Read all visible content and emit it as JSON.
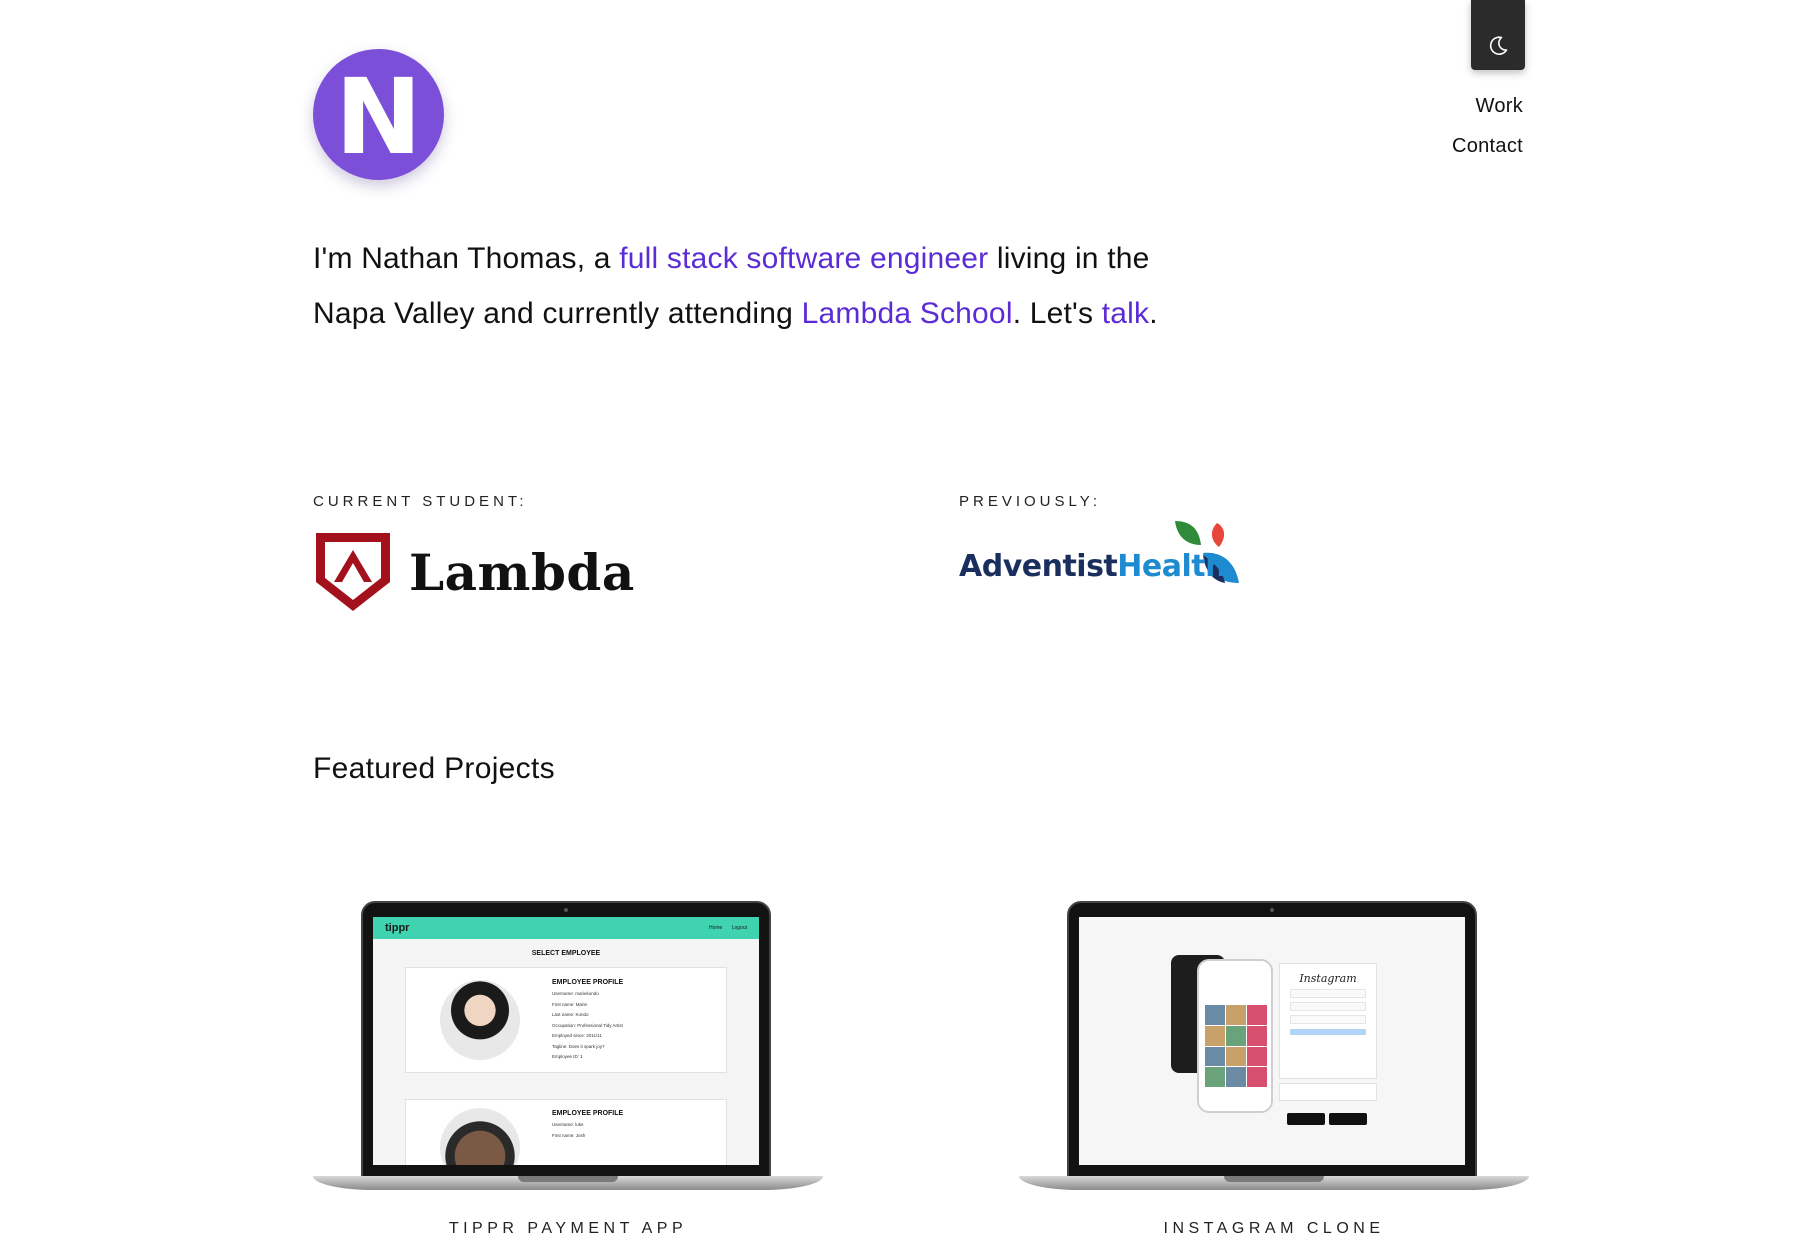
{
  "header": {
    "logo_letter": "N",
    "theme_toggle_icon": "moon-icon",
    "nav": [
      {
        "label": "Work"
      },
      {
        "label": "Contact"
      }
    ]
  },
  "intro": {
    "part1": "I'm Nathan Thomas, a ",
    "link1": "full stack software engineer",
    "part2": " living in the Napa Valley and currently attending ",
    "link2": "Lambda School",
    "part3": ". Let's ",
    "link3": "talk",
    "part4": "."
  },
  "affiliations": {
    "current_label": "CURRENT STUDENT:",
    "current_name": "Lambda",
    "previous_label": "PREVIOUSLY:",
    "previous_name_part1": "Adventist",
    "previous_name_part2": "Health"
  },
  "featured": {
    "title": "Featured Projects",
    "projects": [
      {
        "caption": "TIPPR PAYMENT APP",
        "screen": {
          "brand": "tippr",
          "nav": [
            "Home",
            "Logout"
          ],
          "heading": "SELECT EMPLOYEE",
          "card_title": "EMPLOYEE PROFILE",
          "fields": [
            "Username: mariekondo",
            "First name: Marie",
            "Last name: Kondo",
            "Occupation: Professional Tidy Artist",
            "Employed since: 2011/11",
            "Tagline: Does it spark joy?",
            "Employee ID: 1"
          ],
          "card2_title": "EMPLOYEE PROFILE",
          "card2_fields": [
            "Username: luke",
            "First name: Josh"
          ]
        }
      },
      {
        "caption": "INSTAGRAM CLONE",
        "screen": {
          "brand": "Instagram"
        }
      }
    ]
  },
  "colors": {
    "accent": "#5b2bd6",
    "logo_bg": "#7b4fd8",
    "lambda_red": "#a3111c",
    "tippr_green": "#3fd3b0"
  }
}
